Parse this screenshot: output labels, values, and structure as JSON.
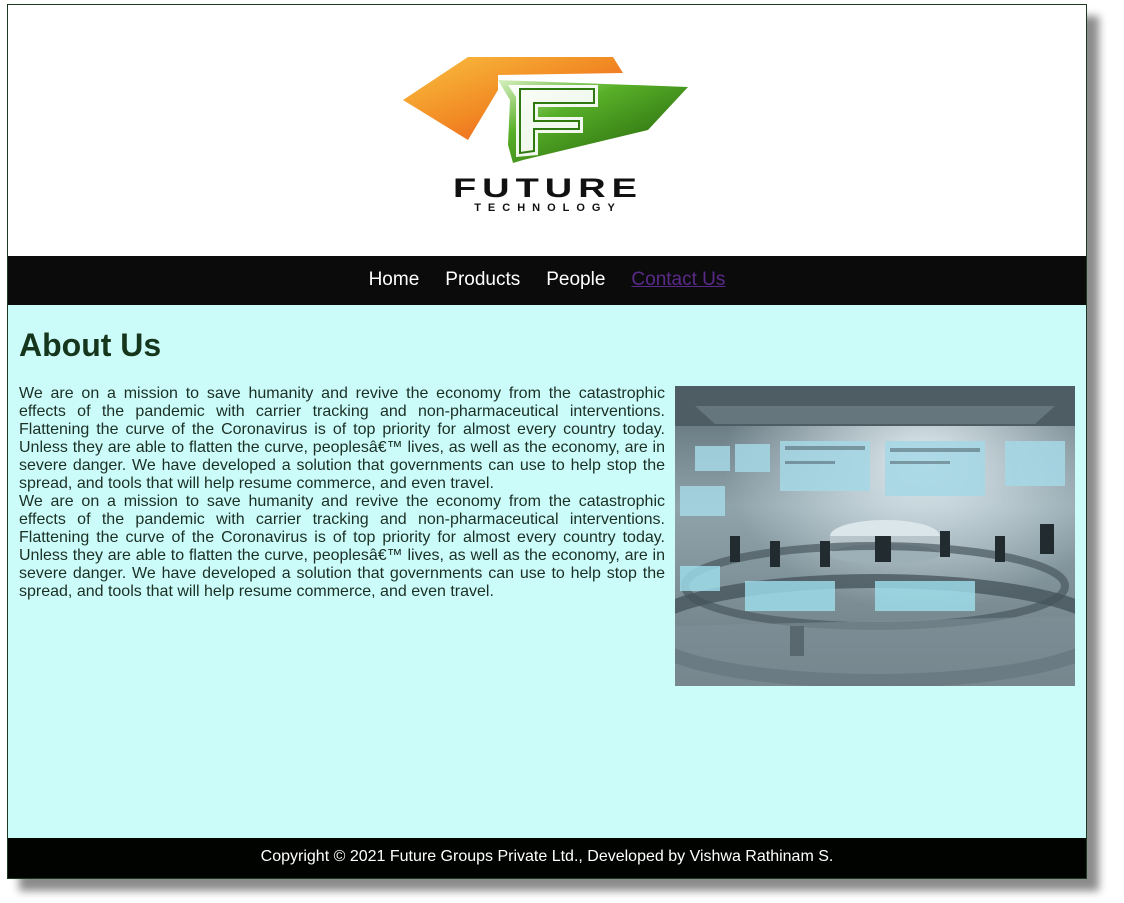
{
  "brand": {
    "logo_icon": "future-technology-logo",
    "logo_title": "FUTURE",
    "logo_subtitle": "TECHNOLOGY",
    "colors": {
      "orange": "#f07a1a",
      "green": "#3a9a12",
      "dark": "#111111"
    }
  },
  "nav": {
    "items": [
      {
        "label": "Home"
      },
      {
        "label": "Products"
      },
      {
        "label": "People"
      },
      {
        "label": "Contact Us"
      }
    ]
  },
  "main": {
    "heading": "About Us",
    "paragraphs": [
      "We are on a mission to save humanity and revive the economy from the catastrophic effects of the pandemic with carrier tracking and non-pharmaceutical interventions. Flattening the curve of the Coronavirus is of top priority for almost every country today. Unless they are able to flatten the curve, peoplesâ€™ lives, as well as the economy, are in severe danger. We have developed a solution that governments can use to help stop the spread, and tools that will help resume commerce, and even travel.",
      "We are on a mission to save humanity and revive the economy from the catastrophic effects of the pandemic with carrier tracking and non-pharmaceutical interventions. Flattening the curve of the Coronavirus is of top priority for almost every country today. Unless they are able to flatten the curve, peoplesâ€™ lives, as well as the economy, are in severe danger. We have developed a solution that governments can use to help stop the spread, and tools that will help resume commerce, and even travel."
    ],
    "image_icon": "control-room-image"
  },
  "footer": {
    "text": "Copyright © 2021 Future Groups Private Ltd., Developed by Vishwa Rathinam S."
  }
}
